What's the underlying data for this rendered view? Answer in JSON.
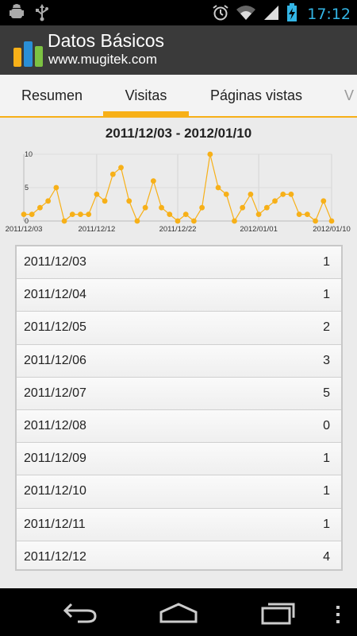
{
  "statusbar": {
    "time": "17:12",
    "icons": [
      "android-debug-icon",
      "usb-icon",
      "alarm-icon",
      "wifi-icon",
      "signal-icon",
      "battery-charging-icon"
    ]
  },
  "actionbar": {
    "title": "Datos Básicos",
    "subtitle": "www.mugitek.com",
    "icon": "bar-chart-app-icon"
  },
  "tabs": [
    {
      "label": "Resumen",
      "active": false
    },
    {
      "label": "Visitas",
      "active": true
    },
    {
      "label": "Páginas vistas",
      "active": false
    },
    {
      "label": "V",
      "active": false
    }
  ],
  "date_range": "2011/12/03 - 2012/01/10",
  "chart_data": {
    "type": "line",
    "x": [
      "2011/12/03",
      "2011/12/04",
      "2011/12/05",
      "2011/12/06",
      "2011/12/07",
      "2011/12/08",
      "2011/12/09",
      "2011/12/10",
      "2011/12/11",
      "2011/12/12",
      "2011/12/13",
      "2011/12/14",
      "2011/12/15",
      "2011/12/16",
      "2011/12/17",
      "2011/12/18",
      "2011/12/19",
      "2011/12/20",
      "2011/12/21",
      "2011/12/22",
      "2011/12/23",
      "2011/12/24",
      "2011/12/25",
      "2011/12/26",
      "2011/12/27",
      "2011/12/28",
      "2011/12/29",
      "2011/12/30",
      "2011/12/31",
      "2012/01/01",
      "2012/01/02",
      "2012/01/03",
      "2012/01/04",
      "2012/01/05",
      "2012/01/06",
      "2012/01/07",
      "2012/01/08",
      "2012/01/09",
      "2012/01/10"
    ],
    "values": [
      1,
      1,
      2,
      3,
      5,
      0,
      1,
      1,
      1,
      4,
      3,
      7,
      8,
      3,
      0,
      2,
      6,
      2,
      1,
      0,
      1,
      0,
      2,
      10,
      5,
      4,
      0,
      2,
      4,
      1,
      2,
      3,
      4,
      4,
      1,
      1,
      0,
      3,
      0
    ],
    "x_tick_labels": [
      "2011/12/03",
      "2011/12/12",
      "2011/12/22",
      "2012/01/01",
      "2012/01/10"
    ],
    "y_tick_labels": [
      "0",
      "5",
      "10"
    ],
    "ylim": [
      0,
      10
    ],
    "grid": true,
    "color": "#f7b018"
  },
  "table": {
    "rows": [
      {
        "date": "2011/12/03",
        "value": "1"
      },
      {
        "date": "2011/12/04",
        "value": "1"
      },
      {
        "date": "2011/12/05",
        "value": "2"
      },
      {
        "date": "2011/12/06",
        "value": "3"
      },
      {
        "date": "2011/12/07",
        "value": "5"
      },
      {
        "date": "2011/12/08",
        "value": "0"
      },
      {
        "date": "2011/12/09",
        "value": "1"
      },
      {
        "date": "2011/12/10",
        "value": "1"
      },
      {
        "date": "2011/12/11",
        "value": "1"
      },
      {
        "date": "2011/12/12",
        "value": "4"
      }
    ]
  },
  "navbar": {
    "buttons": [
      "back-icon",
      "home-icon",
      "recent-apps-icon",
      "menu-icon"
    ]
  },
  "colors": {
    "accent": "#f7b018",
    "clock": "#33b5e5",
    "actionbar": "#3a3a3a"
  }
}
